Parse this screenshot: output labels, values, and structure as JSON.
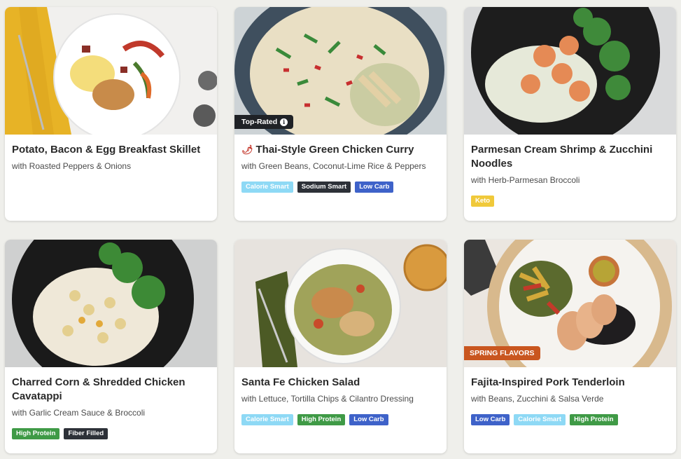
{
  "cards": [
    {
      "title": "Potato, Bacon & Egg Breakfast Skillet",
      "subtitle": "with Roasted Peppers & Onions",
      "tags": []
    },
    {
      "title": "Thai-Style Green Chicken Curry",
      "subtitle": "with Green Beans, Coconut-Lime Rice & Peppers",
      "badge": "Top-Rated",
      "title_icon": "chili-icon",
      "tags": [
        "Calorie Smart",
        "Sodium Smart",
        "Low Carb"
      ]
    },
    {
      "title": "Parmesan Cream Shrimp & Zucchini Noodles",
      "subtitle": "with Herb-Parmesan Broccoli",
      "tags": [
        "Keto"
      ]
    },
    {
      "title": "Charred Corn & Shredded Chicken Cavatappi",
      "subtitle": "with Garlic Cream Sauce & Broccoli",
      "tags": [
        "High Protein",
        "Fiber Filled"
      ]
    },
    {
      "title": "Santa Fe Chicken Salad",
      "subtitle": "with Lettuce, Tortilla Chips & Cilantro Dressing",
      "tags": [
        "Calorie Smart",
        "High Protein",
        "Low Carb"
      ]
    },
    {
      "title": "Fajita-Inspired Pork Tenderloin",
      "subtitle": "with Beans, Zucchini & Salsa Verde",
      "badge": "SPRING FLAVORS",
      "tags": [
        "Low Carb",
        "Calorie Smart",
        "High Protein"
      ]
    }
  ],
  "colors": {
    "tag_calorie_smart": "#8ed9f5",
    "tag_sodium_smart": "#2d3138",
    "tag_low_carb": "#3e62c9",
    "tag_high_protein": "#3f9a46",
    "tag_keto": "#f0c93a",
    "badge_top_rated": "#1f2226",
    "badge_spring": "#c9561f"
  }
}
